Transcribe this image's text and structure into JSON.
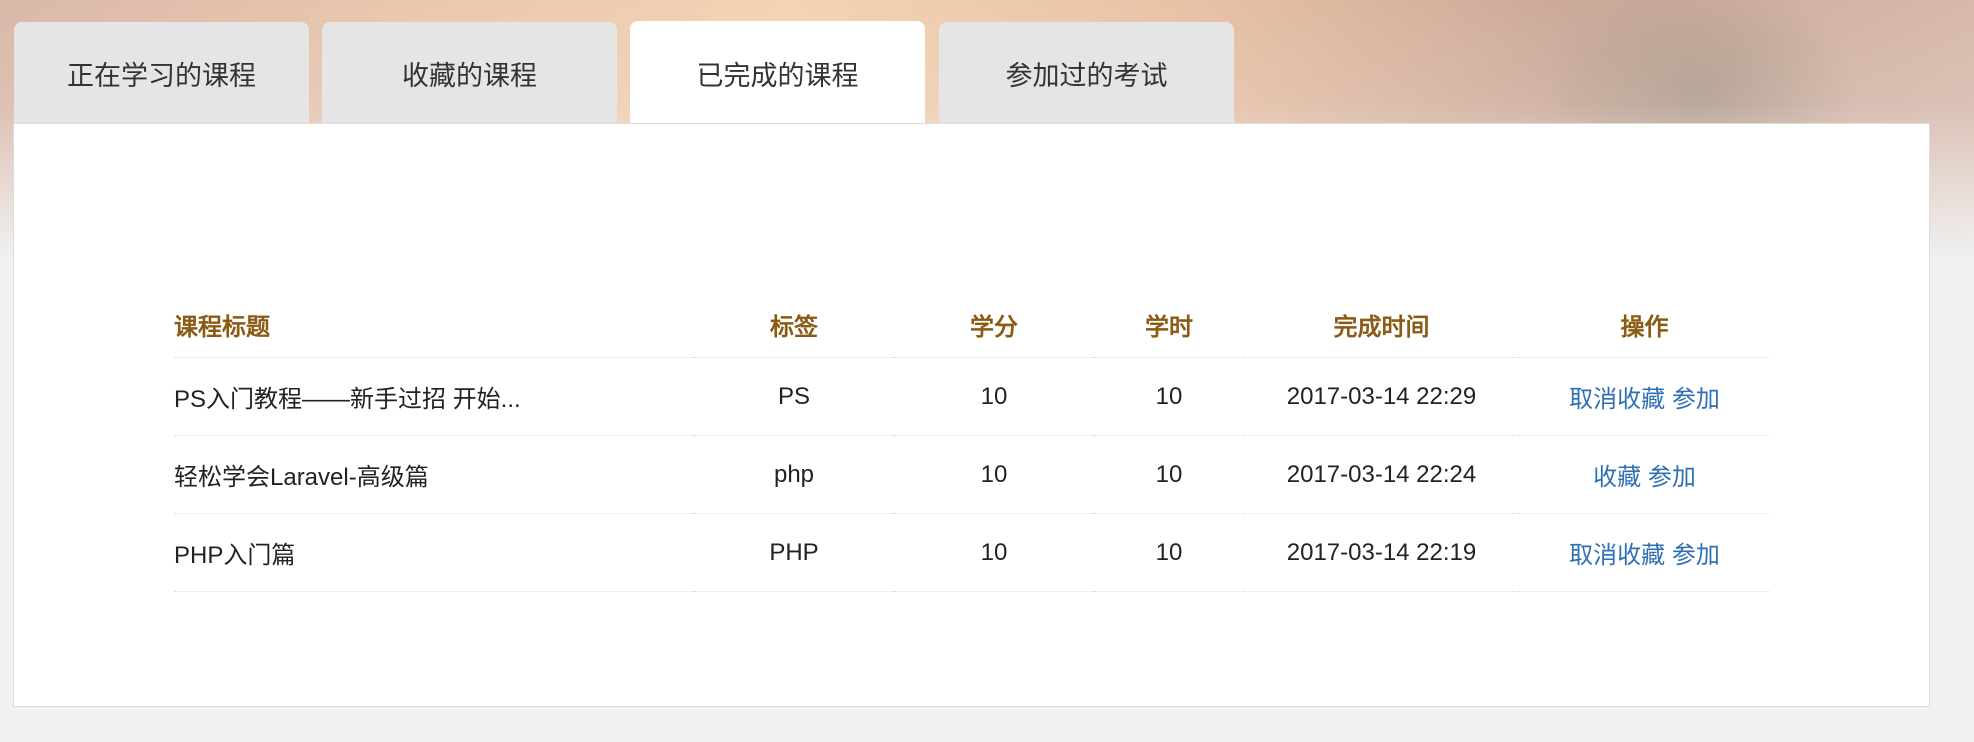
{
  "tabs": [
    {
      "label": "正在学习的课程",
      "active": false
    },
    {
      "label": "收藏的课程",
      "active": false
    },
    {
      "label": "已完成的课程",
      "active": true
    },
    {
      "label": "参加过的考试",
      "active": false
    }
  ],
  "table": {
    "headers": [
      "课程标题",
      "标签",
      "学分",
      "学时",
      "完成时间",
      "操作"
    ],
    "rows": [
      {
        "title": "PS入门教程——新手过招 开始...",
        "tag": "PS",
        "credit": "10",
        "hours": "10",
        "completed": "2017-03-14 22:29",
        "fav": "取消收藏",
        "join": "参加"
      },
      {
        "title": "轻松学会Laravel-高级篇",
        "tag": "php",
        "credit": "10",
        "hours": "10",
        "completed": "2017-03-14 22:24",
        "fav": "收藏",
        "join": "参加"
      },
      {
        "title": "PHP入门篇",
        "tag": "PHP",
        "credit": "10",
        "hours": "10",
        "completed": "2017-03-14 22:19",
        "fav": "取消收藏",
        "join": "参加"
      }
    ]
  },
  "colors": {
    "header_text": "#8b5a14",
    "link": "#2f6fb3",
    "tab_inactive": "#e5e5e5"
  }
}
